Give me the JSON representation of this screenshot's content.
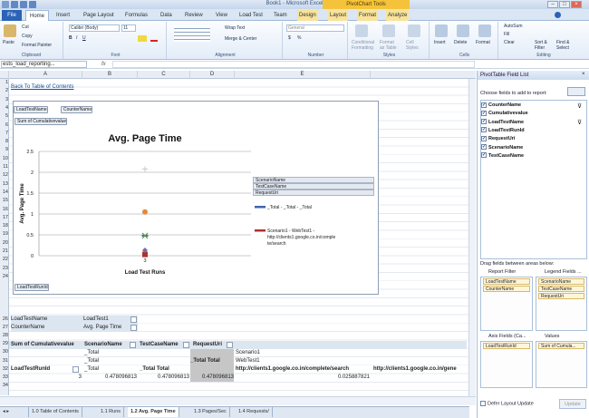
{
  "window": {
    "title": "Book1 - Microsoft Excel",
    "context_tab_group": "PivotChart Tools"
  },
  "tabs": [
    {
      "label": "File"
    },
    {
      "label": "Home"
    },
    {
      "label": "Insert"
    },
    {
      "label": "Page Layout"
    },
    {
      "label": "Formulas"
    },
    {
      "label": "Data"
    },
    {
      "label": "Review"
    },
    {
      "label": "View"
    },
    {
      "label": "Load Test"
    },
    {
      "label": "Team"
    },
    {
      "label": "Design"
    },
    {
      "label": "Layout"
    },
    {
      "label": "Format"
    },
    {
      "label": "Analyze"
    }
  ],
  "ribbon": {
    "clipboard": {
      "label": "Clipboard",
      "paste": "Paste",
      "cut": "Cut",
      "copy": "Copy",
      "painter": "Format Painter"
    },
    "font": {
      "label": "Font",
      "name": "Calibri (Body)",
      "size": "11",
      "bold": "B",
      "italic": "I",
      "underline": "U"
    },
    "alignment": {
      "label": "Alignment",
      "wrap": "Wrap Text",
      "merge": "Merge & Center"
    },
    "number": {
      "label": "Number",
      "format": "General",
      "currency": "$",
      "percent": "%"
    },
    "styles": {
      "label": "Styles",
      "cond": "Conditional Formatting",
      "table": "Format as Table",
      "cell": "Cell Styles"
    },
    "cells": {
      "label": "Cells",
      "insert": "Insert",
      "delete": "Delete",
      "format": "Format"
    },
    "editing": {
      "label": "Editing",
      "autosum": "AutoSum",
      "fill": "Fill",
      "clear": "Clear",
      "sort": "Sort & Filter",
      "find": "Find & Select"
    }
  },
  "formula_bar": {
    "name_box": "ests_load_reporting...",
    "fx": "fx",
    "value": ""
  },
  "columns": [
    "A",
    "B",
    "C",
    "D",
    "E"
  ],
  "rows": {
    "top": [
      "1",
      "2",
      "3",
      "4",
      "5",
      "6",
      "7",
      "8",
      "9",
      "10",
      "11",
      "12",
      "13",
      "14",
      "15",
      "16",
      "17",
      "18",
      "19",
      "20",
      "21",
      "22",
      "23",
      "24"
    ],
    "bottom": [
      "26",
      "27",
      "28",
      "29",
      "30",
      "31",
      "32",
      "33",
      "34"
    ]
  },
  "sheet": {
    "back_link": "Back To Table of Contents",
    "filters": [
      {
        "label": "LoadTestName",
        "value": "LoadTest1"
      },
      {
        "label": "CounterName",
        "value": "Avg. Page Time"
      }
    ],
    "pivot_header": [
      "Sum of Cumulativevalue",
      "ScenarioName",
      "TestCaseName",
      "RequestUri"
    ],
    "row30": [
      "_Total",
      "",
      "",
      "Scenario1"
    ],
    "row31": [
      "_Total",
      "",
      "_Total Total",
      "WebTest1"
    ],
    "row32": [
      "LoadTestRunId",
      "_Total",
      "_Total Total",
      "",
      "http://clients1.google.co.in/complete/search",
      "http://clients1.google.co.in/gene"
    ],
    "row33": [
      "3",
      "0.478096813",
      "0.478096813",
      "0.478096813",
      "0.025887821"
    ]
  },
  "chart": {
    "filter_buttons": [
      "LoadTestName",
      "CounterName"
    ],
    "value_button": "Sum of Cumulativevalue",
    "axis_field_button": "LoadTestRunId",
    "legend_fields": [
      "ScenarioName",
      "TestCaseName",
      "RequestUri"
    ],
    "legend_entries": [
      "_Total - _Total - _Total",
      "Scenario1 - WebTest1 - http://clients1.google.co.in/complete/search"
    ]
  },
  "chart_data": {
    "type": "scatter",
    "title": "Avg. Page Time",
    "xlabel": "Load Test Runs",
    "ylabel": "Avg. Page Time",
    "categories": [
      "3"
    ],
    "ylim": [
      0,
      2.5
    ],
    "yticks": [
      "0",
      "0.5",
      "1",
      "1.5",
      "2",
      "2.5"
    ],
    "grid": true,
    "legend_position": "right",
    "series": [
      {
        "name": "_Total - _Total - _Total",
        "color": "#3c66a8",
        "marker": "dash",
        "values": [
          0.48
        ]
      },
      {
        "name": "Scenario1 - WebTest1 - http://clients1.google.co.in/complete/search",
        "color": "#b03030",
        "marker": "square",
        "values": [
          0.03
        ]
      },
      {
        "color": "#c8c8c8",
        "marker": "plus",
        "values": [
          2.08
        ]
      },
      {
        "color": "#e08a3a",
        "marker": "circle",
        "values": [
          1.05
        ]
      },
      {
        "color": "#6a9a4a",
        "marker": "x",
        "values": [
          0.48
        ]
      },
      {
        "color": "#7c6aa0",
        "marker": "diamond",
        "values": [
          0.13
        ]
      }
    ]
  },
  "sheet_tabs": [
    "1.0 Table of Contents",
    "1.1 Runs",
    "1.2 Avg. Page Time",
    "1.3 Pages/Sec",
    "1.4 Requests/"
  ],
  "active_sheet": "1.2 Avg. Page Time",
  "pivot_pane": {
    "title": "PivotTable Field List",
    "choose_label": "Choose fields to add to report:",
    "fields": [
      {
        "label": "CounterName",
        "checked": true
      },
      {
        "label": "Cumulativevalue",
        "checked": true
      },
      {
        "label": "LoadTestName",
        "checked": true
      },
      {
        "label": "LoadTestRunId",
        "checked": true
      },
      {
        "label": "RequestUri",
        "checked": true
      },
      {
        "label": "ScenarioName",
        "checked": true
      },
      {
        "label": "TestCaseName",
        "checked": true
      }
    ],
    "drag_label": "Drag fields between areas below:",
    "areas": {
      "report_filter": {
        "label": "Report Filter",
        "items": [
          "LoadTestName",
          "CounterName"
        ]
      },
      "legend_fields": {
        "label": "Legend Fields ...",
        "items": [
          "ScenarioName",
          "TestCaseName",
          "RequestUri"
        ]
      },
      "axis_fields": {
        "label": "Axis Fields (Ca...",
        "items": [
          "LoadTestRunId"
        ]
      },
      "values": {
        "label": "Values",
        "items": [
          "Sum of Cumula..."
        ]
      }
    },
    "defer_label": "Defer Layout Update",
    "update_button": "Update"
  }
}
